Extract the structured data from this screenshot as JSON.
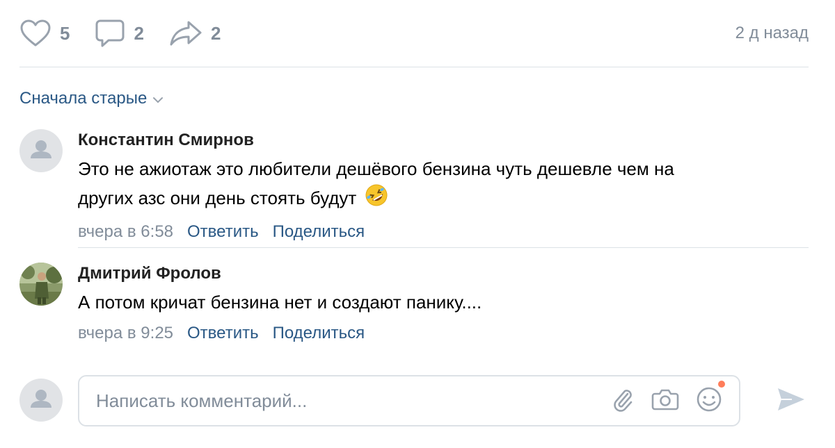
{
  "colors": {
    "link": "#2a5885",
    "muted": "#818c99",
    "divider": "#dce1e6",
    "notification_dot": "#ff7d5a"
  },
  "actions": {
    "likes": {
      "icon": "heart-icon",
      "count": "5"
    },
    "comments": {
      "icon": "comment-icon",
      "count": "2"
    },
    "shares": {
      "icon": "share-icon",
      "count": "2"
    },
    "time": "2 д назад"
  },
  "sort": {
    "label": "Сначала старые",
    "icon": "chevron-down-icon"
  },
  "comments": [
    {
      "author": "Константин Смирнов",
      "text_line1": "Это не ажиотаж это любители дешёвого бензина чуть дешевле чем на",
      "text_line2": "других азс они день стоять будут",
      "emoji": "rolling-on-floor-laughing-emoji",
      "time": "вчера в 6:58",
      "reply": "Ответить",
      "share": "Поделиться",
      "avatar": "default-avatar"
    },
    {
      "author": "Дмитрий Фролов",
      "text_line1": "А потом кричат бензина нет и создают панику....",
      "time": "вчера в 9:25",
      "reply": "Ответить",
      "share": "Поделиться",
      "avatar": "photo-avatar"
    }
  ],
  "composer": {
    "placeholder": "Написать комментарий...",
    "icons": [
      "paperclip-icon",
      "camera-icon",
      "smile-icon",
      "send-icon"
    ]
  }
}
